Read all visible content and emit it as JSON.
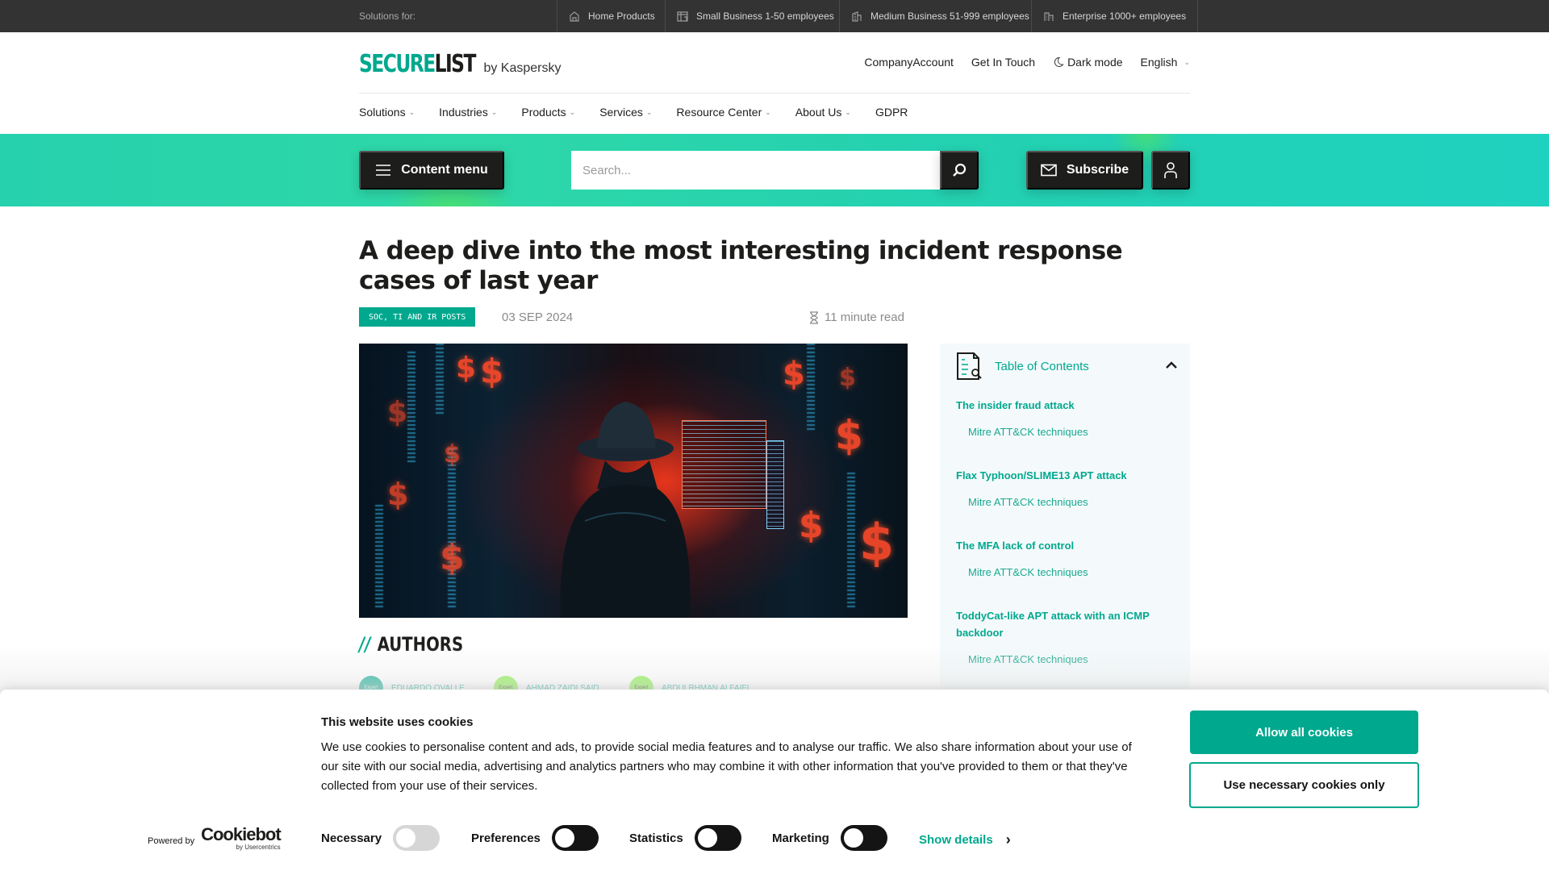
{
  "topbar": {
    "label": "Solutions for:",
    "items": [
      {
        "label": "Home Products",
        "icon": "house-icon"
      },
      {
        "label": "Small Business 1-50 employees",
        "icon": "shop-icon"
      },
      {
        "label": "Medium Business 51-999 employees",
        "icon": "office-building-icon"
      },
      {
        "label": "Enterprise 1000+ employees",
        "icon": "skyscraper-icon"
      }
    ]
  },
  "header": {
    "logo_secure": "SECURE",
    "logo_list": "LIST",
    "logo_by": "by Kaspersky",
    "links": {
      "company_account": "CompanyAccount",
      "get_in_touch": "Get In Touch",
      "dark_mode": "Dark mode",
      "language": "English"
    },
    "nav": [
      "Solutions",
      "Industries",
      "Products",
      "Services",
      "Resource Center",
      "About Us",
      "GDPR"
    ]
  },
  "band": {
    "content_menu": "Content menu",
    "search_placeholder": "Search...",
    "subscribe": "Subscribe"
  },
  "article": {
    "title": "A deep dive into the most interesting incident response cases of last year",
    "tag": "SOC, TI AND IR POSTS",
    "date": "03 SEP 2024",
    "read_time": "11 minute read",
    "authors_heading": "AUTHORS",
    "authors_slash": "//",
    "authors": [
      {
        "name": "EDUARDO OVALLE",
        "badge": "Expert",
        "color": "#00a88e"
      },
      {
        "name": "AHMAD ZAIDI SAID",
        "badge": "Expert",
        "color": "#7ef03a"
      },
      {
        "name": "ABDULRHMAN ALFAIFI",
        "badge": "Expert",
        "color": "#7ef03a"
      }
    ]
  },
  "toc": {
    "title": "Table of Contents",
    "sections": [
      {
        "title": "The insider fraud attack",
        "sub": "Mitre ATT&CK techniques"
      },
      {
        "title": "Flax Typhoon/SLIME13 APT attack",
        "sub": "Mitre ATT&CK techniques"
      },
      {
        "title": "The MFA lack of control",
        "sub": "Mitre ATT&CK techniques"
      },
      {
        "title": "ToddyCat-like APT attack with an ICMP backdoor",
        "sub": "Mitre ATT&CK techniques"
      }
    ]
  },
  "cookie": {
    "title": "This website uses cookies",
    "text": "We use cookies to personalise content and ads, to provide social media features and to analyse our traffic. We also share information about your use of our site with our social media, advertising and analytics partners who may combine it with other information that you've provided to them or that they've collected from your use of their services.",
    "allow_all": "Allow all cookies",
    "necessary_only": "Use necessary cookies only",
    "powered_by": "Powered by",
    "brand": "Cookiebot",
    "brand_sub": "by Usercentrics",
    "toggles": [
      {
        "label": "Necessary",
        "state": "on-disabled"
      },
      {
        "label": "Preferences",
        "state": "off"
      },
      {
        "label": "Statistics",
        "state": "off"
      },
      {
        "label": "Marketing",
        "state": "off"
      }
    ],
    "show_details": "Show details"
  },
  "colors": {
    "brand": "#00a88e",
    "dark": "#1d1d1b",
    "topbar": "#333333"
  }
}
